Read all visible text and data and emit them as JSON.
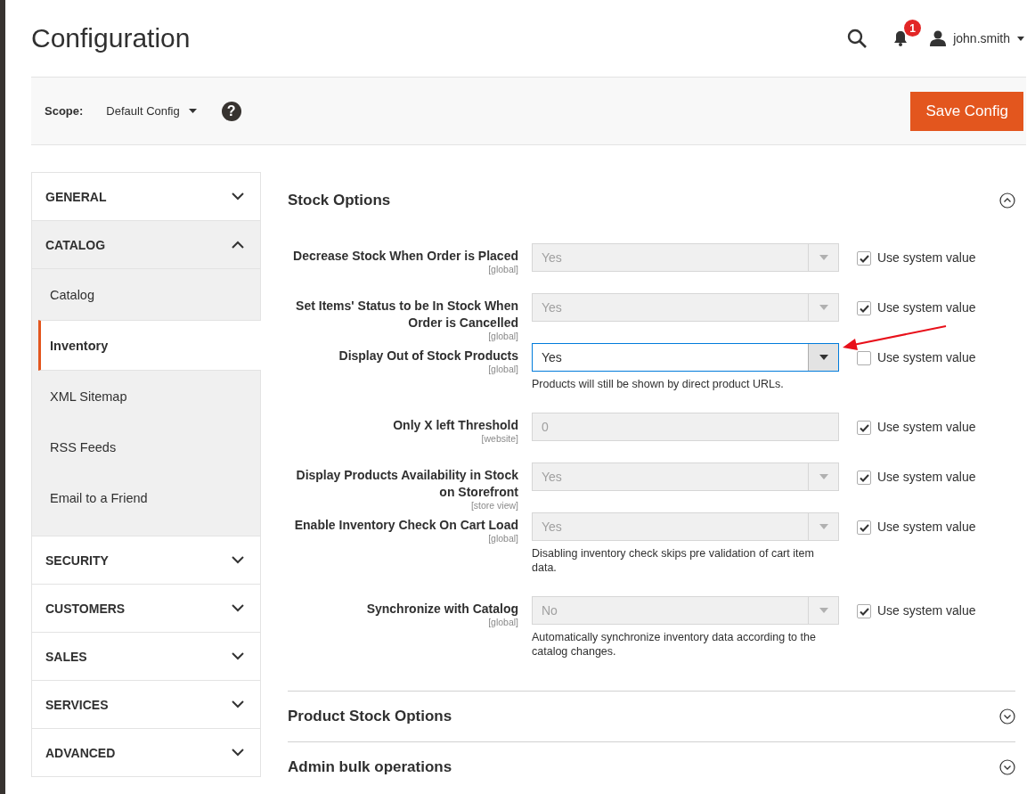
{
  "header": {
    "title": "Configuration",
    "notifications": "1",
    "user": "john.smith"
  },
  "scope_bar": {
    "label": "Scope:",
    "value": "Default Config",
    "help": "?",
    "save_button": "Save Config"
  },
  "sidebar": {
    "items": [
      {
        "label": "GENERAL",
        "expanded": false
      },
      {
        "label": "CATALOG",
        "expanded": true,
        "children": [
          {
            "label": "Catalog",
            "selected": false
          },
          {
            "label": "Inventory",
            "selected": true
          },
          {
            "label": "XML Sitemap",
            "selected": false
          },
          {
            "label": "RSS Feeds",
            "selected": false
          },
          {
            "label": "Email to a Friend",
            "selected": false
          }
        ]
      },
      {
        "label": "SECURITY",
        "expanded": false
      },
      {
        "label": "CUSTOMERS",
        "expanded": false
      },
      {
        "label": "SALES",
        "expanded": false
      },
      {
        "label": "SERVICES",
        "expanded": false
      },
      {
        "label": "ADVANCED",
        "expanded": false
      }
    ]
  },
  "sections": [
    {
      "title": "Stock Options",
      "expanded": true,
      "fields": [
        {
          "label": "Decrease Stock When Order is Placed",
          "scope": "[global]",
          "kind": "select",
          "value": "Yes",
          "use_system_value": {
            "label": "Use system value",
            "checked": true
          }
        },
        {
          "label": "Set Items' Status to be In Stock When Order is Cancelled",
          "scope": "[global]",
          "kind": "select",
          "value": "Yes",
          "use_system_value": {
            "label": "Use system value",
            "checked": true
          }
        },
        {
          "label": "Display Out of Stock Products",
          "scope": "[global]",
          "kind": "select",
          "value": "Yes",
          "note": "Products will still be shown by direct product URLs.",
          "use_system_value": {
            "label": "Use system value",
            "checked": false
          }
        },
        {
          "label": "Only X left Threshold",
          "scope": "[website]",
          "kind": "text",
          "value": "0",
          "use_system_value": {
            "label": "Use system value",
            "checked": true
          }
        },
        {
          "label": "Display Products Availability in Stock on Storefront",
          "scope": "[store view]",
          "kind": "select",
          "value": "Yes",
          "use_system_value": {
            "label": "Use system value",
            "checked": true
          }
        },
        {
          "label": "Enable Inventory Check On Cart Load",
          "scope": "[global]",
          "kind": "select",
          "value": "Yes",
          "note": "Disabling inventory check skips pre validation of cart item data.",
          "use_system_value": {
            "label": "Use system value",
            "checked": true
          }
        },
        {
          "label": "Synchronize with Catalog",
          "scope": "[global]",
          "kind": "select",
          "value": "No",
          "note": "Automatically synchronize inventory data according to the catalog changes.",
          "use_system_value": {
            "label": "Use system value",
            "checked": true
          }
        }
      ]
    },
    {
      "title": "Product Stock Options",
      "expanded": false
    },
    {
      "title": "Admin bulk operations",
      "expanded": false
    }
  ]
}
